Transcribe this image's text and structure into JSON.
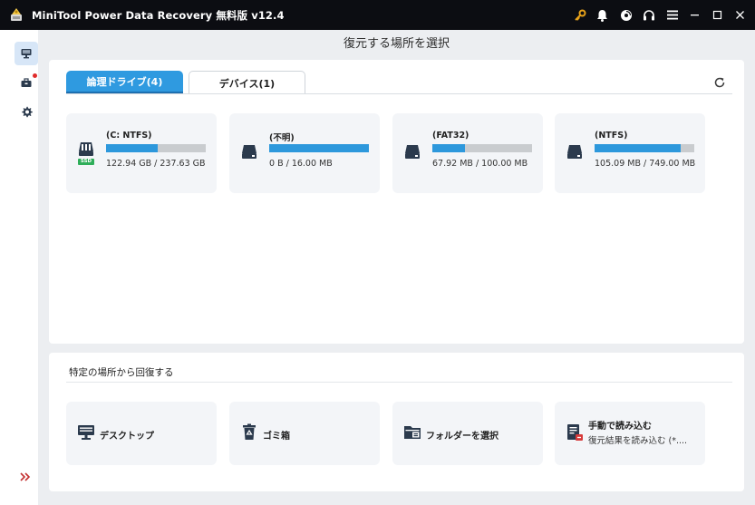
{
  "titlebar": {
    "title": "MiniTool Power Data Recovery 無料版 v12.4",
    "icons": [
      "key-icon",
      "bell-icon",
      "disc-icon",
      "headset-icon",
      "menu-icon",
      "minimize-icon",
      "maximize-icon",
      "close-icon"
    ]
  },
  "sidebar": {
    "items": [
      {
        "name": "this-pc",
        "icon": "monitor-icon",
        "active": true
      },
      {
        "name": "toolbox",
        "icon": "toolbox-icon",
        "badge": true
      },
      {
        "name": "settings",
        "icon": "gear-icon"
      }
    ],
    "expand_icon": "double-chevron-right-icon"
  },
  "header": {
    "title": "復元する場所を選択"
  },
  "tabs": [
    {
      "label": "論理ドライブ(4)",
      "active": true
    },
    {
      "label": "デバイス(1)",
      "active": false
    }
  ],
  "drives": [
    {
      "label": "(C: NTFS)",
      "size": "122.94 GB / 237.63 GB",
      "used_fraction": 0.52,
      "badge": "SSD"
    },
    {
      "label": "(不明)",
      "size": "0 B / 16.00 MB",
      "used_fraction": 1.0
    },
    {
      "label": "(FAT32)",
      "size": "67.92 MB / 100.00 MB",
      "used_fraction": 0.33
    },
    {
      "label": "(NTFS)",
      "size": "105.09 MB / 749.00 MB",
      "used_fraction": 0.86
    }
  ],
  "specific_locations": {
    "title": "特定の場所から回復する",
    "items": [
      {
        "label": "デスクトップ",
        "icon": "desktop-icon"
      },
      {
        "label": "ゴミ箱",
        "icon": "recycle-bin-icon"
      },
      {
        "label": "フォルダーを選択",
        "icon": "folder-icon"
      },
      {
        "label": "手動で読み込む",
        "sub": "復元結果を読み込む (*....",
        "icon": "load-file-icon"
      }
    ]
  },
  "colors": {
    "accent": "#2f9ae0",
    "bar_fill": "#2d98dc",
    "bar_track": "#c9cccf",
    "titlebar": "#0c0d12",
    "key_icon": "#e8a21a"
  }
}
